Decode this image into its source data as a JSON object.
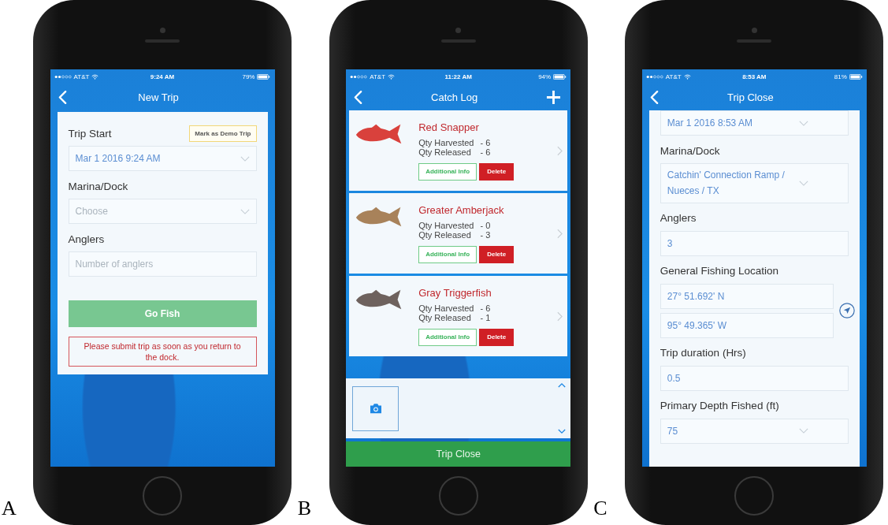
{
  "panels": [
    {
      "label": "A",
      "kind": "new_trip",
      "status": {
        "carrier": "AT&T",
        "time": "9:24 AM",
        "battery": "79%"
      },
      "nav": {
        "title": "New Trip"
      },
      "fields": [
        {
          "kind": "select",
          "label": "Trip Start",
          "action": "Mark as Demo Trip",
          "value": "Mar 1 2016 9:24 AM"
        },
        {
          "kind": "select",
          "label": "Marina/Dock",
          "placeholder": "Choose"
        },
        {
          "kind": "input",
          "label": "Anglers",
          "placeholder": "Number of anglers"
        }
      ],
      "primary_button": "Go Fish",
      "notice": "Please submit trip as soon as you return to the dock."
    },
    {
      "label": "B",
      "kind": "catch_log",
      "status": {
        "carrier": "AT&T",
        "time": "11:22 AM",
        "battery": "94%"
      },
      "nav": {
        "title": "Catch Log",
        "add": true
      },
      "catches": [
        {
          "name": "Red Snapper",
          "color": "#d9413c",
          "stats": [
            {
              "label": "Qty Harvested",
              "value": "- 6"
            },
            {
              "label": "Qty Released",
              "value": "- 6"
            }
          ],
          "buttons": [
            "Additional Info",
            "Delete"
          ]
        },
        {
          "name": "Greater Amberjack",
          "color": "#a8825a",
          "stats": [
            {
              "label": "Qty Harvested",
              "value": "- 0"
            },
            {
              "label": "Qty Released",
              "value": "- 3"
            }
          ],
          "buttons": [
            "Additional Info",
            "Delete"
          ]
        },
        {
          "name": "Gray Triggerfish",
          "color": "#6e625e",
          "stats": [
            {
              "label": "Qty Harvested",
              "value": "- 6"
            },
            {
              "label": "Qty Released",
              "value": "- 1"
            }
          ],
          "buttons": [
            "Additional Info",
            "Delete"
          ]
        }
      ],
      "bottom_button": "Trip Close"
    },
    {
      "label": "C",
      "kind": "trip_close",
      "status": {
        "carrier": "AT&T",
        "time": "8:53 AM",
        "battery": "81%"
      },
      "nav": {
        "title": "Trip Close"
      },
      "fields": [
        {
          "kind": "select",
          "value": "Mar 1 2016 8:53 AM"
        },
        {
          "kind": "select",
          "label": "Marina/Dock",
          "value": "Catchin' Connection Ramp / Nueces / TX"
        },
        {
          "kind": "input",
          "label": "Anglers",
          "value": "3"
        },
        {
          "kind": "coords",
          "label": "General Fishing Location",
          "values": [
            "27° 51.692' N",
            "95° 49.365' W"
          ]
        },
        {
          "kind": "input",
          "label": "Trip duration (Hrs)",
          "value": "0.5"
        },
        {
          "kind": "select",
          "label": "Primary Depth Fished (ft)",
          "value": "75"
        }
      ]
    }
  ]
}
